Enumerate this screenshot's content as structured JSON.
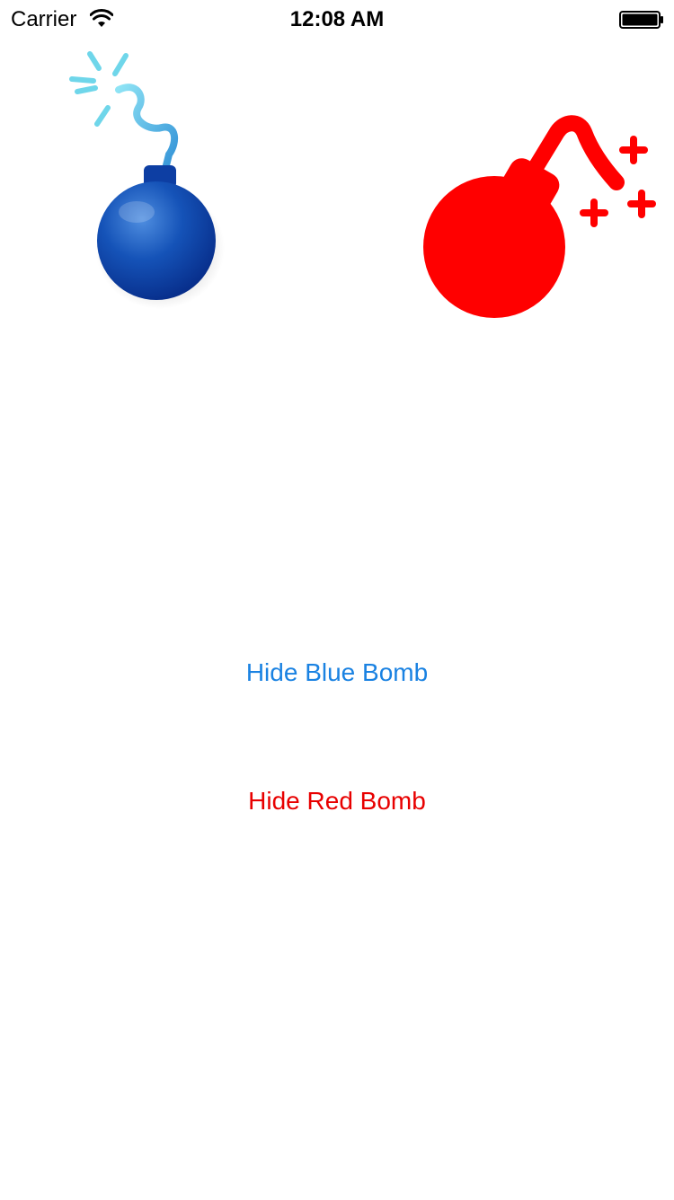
{
  "status_bar": {
    "carrier": "Carrier",
    "time": "12:08 AM",
    "wifi_icon": "wifi-icon",
    "battery_icon": "battery-full-icon"
  },
  "bombs": {
    "blue": {
      "icon": "blue-bomb-icon",
      "color": "#0b3fa8"
    },
    "red": {
      "icon": "red-bomb-icon",
      "color": "#ff0000"
    }
  },
  "buttons": {
    "hide_blue_label": "Hide Blue Bomb",
    "hide_blue_color": "#1a82e2",
    "hide_red_label": "Hide Red Bomb",
    "hide_red_color": "#e80000"
  }
}
